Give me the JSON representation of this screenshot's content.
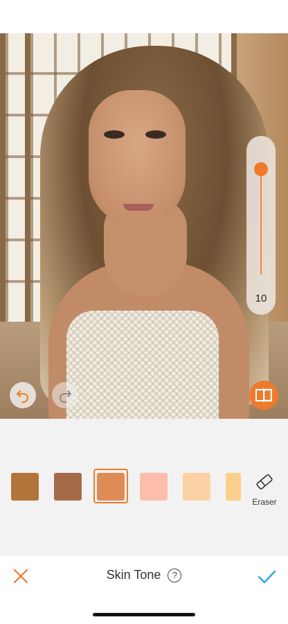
{
  "canvas": {
    "photo": "portrait-photo"
  },
  "slider": {
    "value": "10",
    "level": 1.0,
    "accent": "#f07a2a"
  },
  "overlay_buttons": {
    "undo_icon": "undo-arrow-icon",
    "redo_icon": "redo-arrow-icon",
    "compare_icon": "compare-split-icon"
  },
  "palette": {
    "swatches": [
      {
        "color": "#b27438",
        "selected": false
      },
      {
        "color": "#a56a48",
        "selected": false
      },
      {
        "color": "#df8b55",
        "selected": true
      },
      {
        "color": "#fcbeaa",
        "selected": false
      },
      {
        "color": "#fcd2a4",
        "selected": false
      },
      {
        "color": "#fdcf8c",
        "selected": false
      }
    ],
    "eraser_label": "Eraser",
    "eraser_icon": "eraser-icon"
  },
  "bottom_bar": {
    "title": "Skin Tone",
    "help_glyph": "?",
    "cancel_icon": "close-icon",
    "apply_icon": "checkmark-icon",
    "cancel_color": "#f07a2a",
    "apply_color": "#2aa6e0"
  }
}
